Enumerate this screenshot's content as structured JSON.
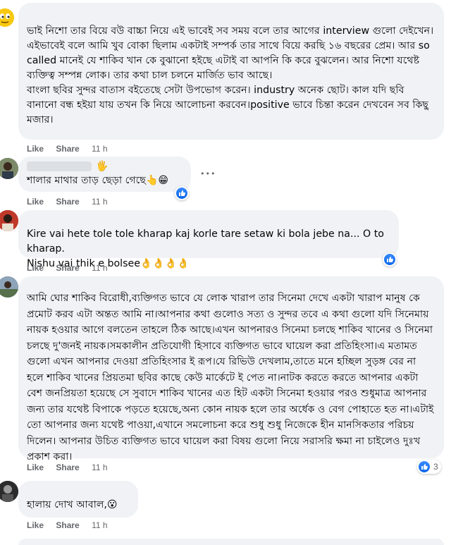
{
  "actions": {
    "like": "Like",
    "share": "Share"
  },
  "comments": [
    {
      "text": "ভাই নিশো তার বিয়ে বউ বাচ্চা নিয়ে এই ভাবেই সব সময় বলে তার আগের interview গুলো দেইখেন। এইভাবেই বলে আমি খুব বোকা ছিলাম একটাই সম্পর্ক তার সাথে বিয়ে করছি ১৬ বছরের প্রেম। আর so called মানেই যে শাকিব খান কে বুঝানো হইছে এটাই বা আপনি কি করে বুঝলেন। আর নিশো যথেষ্ট ব্যক্তিত্ব সম্পন্ন লোক। তার কথা চাল চলনে মার্জিত ভাব আছে।\nবাংলা ছবির সুন্দর বাতাস বইতেছে সেটা উপভোগ করেন। industry অনেক ছোট। কাল যদি ছবি বানানো বন্ধ হইয়া যায় তখন কি নিয়ে আলোচনা করবেন।positive ভাবে চিন্তা করেন দেখবেন সব কিছু মজার।",
      "time": "11 h"
    },
    {
      "text": "শালার মাথার তাড় ছেড়া গেছে",
      "emoji_suffix": "👆😁",
      "author_suffix_emoji": "🖐",
      "time": "11 h"
    },
    {
      "text": "Kire vai hete tole tole kharap kaj korle tare setaw ki bola jebe na... O to kharap.\nNishu vai thik e bolsee",
      "emoji_suffix": "👌👌👌👌",
      "time": "11 h"
    },
    {
      "text": "আমি ঘোর শাকিব বিরোধী,ব্যক্তিগত ভাবে যে লোক খারাপ তার সিনেমা দেখে একটা খারাপ মানুষ কে প্রমোট করব এটা অন্তত আমি না।আপনার কথা গুলোও সত্য ও সুন্দর তবে এ কথা গুলো যদি সিনেমায় নায়ক হওয়ার আগে বলতেন তাহলে ঠিক আছে।এখন আপনারও সিনেমা চলছে শাকিব খানের ও সিনেমা চলছে দু'জনই নায়ক।সমকালীন প্রতিযোগী হিসাবে ব্যক্তিগত ভাবে ঘায়েল করা প্রতিহিংসা।এ মতামত গুলো এখন আপনার দেওয়া প্রতিহিংসার ই রূপ।যে রিভিউ দেখলাম,তাতে মনে হচ্ছিল সুড়ঙ্গ বের না হলে শাকিব খানের প্রিয়তমা ছবির কাছে কেউ মার্কেটে ই পেত না।নাটক করতে করতে আপনার একটা বেশ জনপ্রিয়তা হয়েছে সে সুবাদে শাকিব খানের এত হিট একটা সিনেমা হওয়ার পরও শুধুমাত্র আপনার জন্য তার যথেষ্ট বিপাকে পড়তে হয়েছে,অন্য কোন নায়ক হলে তার অর্ধেক ও বেগ পোহাতে হত না।এটাই তো আপনার জন্য যথেষ্ট পাওয়া,এখানে সমলোচনা করে শুধু শুধু নিজেকে হীন মানসিকতার পরিচয় দিলেন। আপনার উচিত ব্যক্তিগত ভাবে ঘায়েল করা বিষয় গুলো নিয়ে সরাসরি ক্ষমা না চাইলেও দুঃখ প্রকাশ করা।",
      "time": "11 h",
      "reaction_count": "3"
    },
    {
      "text": "হালায় দোখ আবাল,",
      "emoji_suffix": "😮",
      "time": "11 h"
    }
  ],
  "more_options": "•••",
  "colors": {
    "bubble": "#f0f2f5",
    "meta": "#65676b",
    "like_blue": "#0a66e8"
  }
}
